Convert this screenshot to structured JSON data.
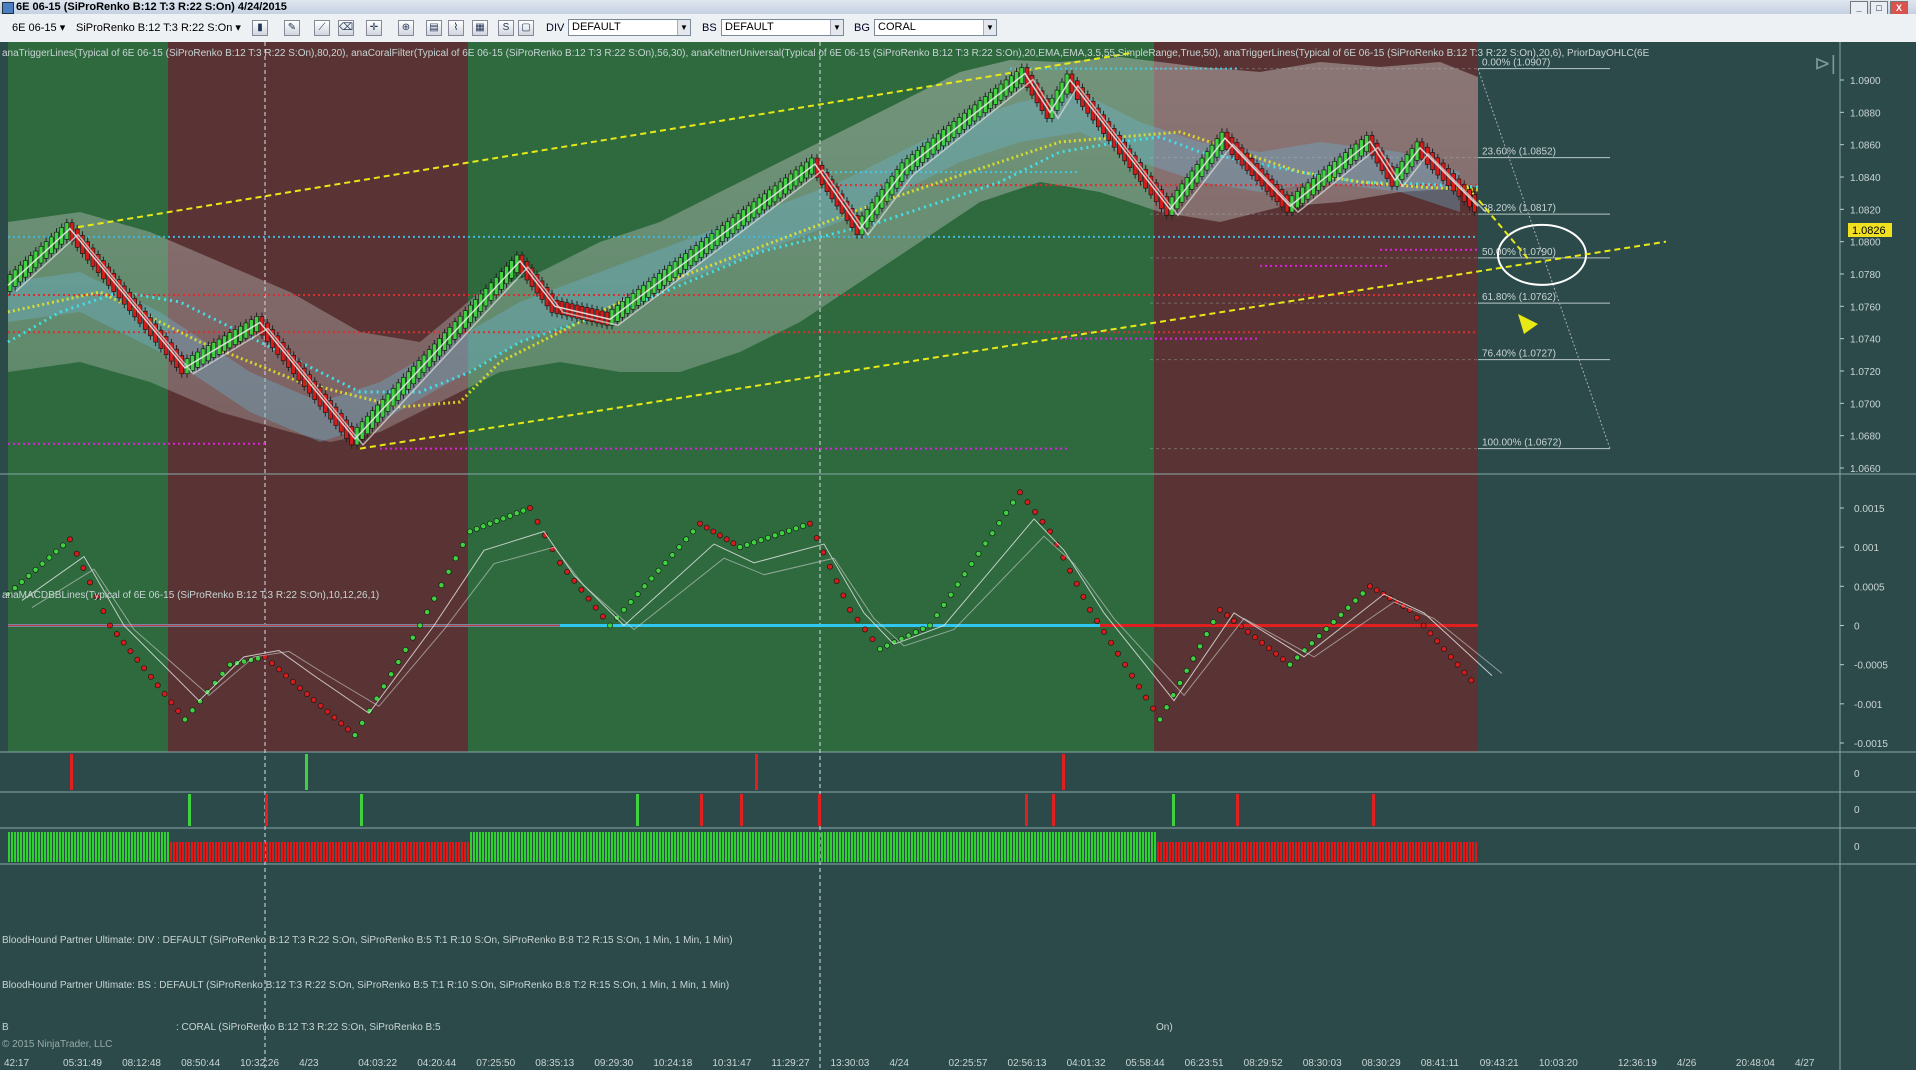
{
  "window": {
    "title": "6E 06-15 (SiProRenko B:12 T:3 R:22 S:On)  4/24/2015",
    "minimize": "_",
    "maximize": "□",
    "close": "X"
  },
  "toolbar": {
    "instrument": "6E 06-15 ▾",
    "bartype": "SiProRenko B:12 T:3 R:22 S:On ▾",
    "div_label": "DIV",
    "div_value": "DEFAULT",
    "bs_label": "BS",
    "bs_value": "DEFAULT",
    "bg_label": "BG",
    "bg_value": "CORAL"
  },
  "panels": {
    "price_header": "anaTriggerLines(Typical of 6E 06-15 (SiProRenko B:12 T:3 R:22 S:On),80,20), anaCoralFilter(Typical of 6E 06-15 (SiProRenko B:12 T:3 R:22 S:On),56,30), anaKeltnerUniversal(Typical of 6E 06-15 (SiProRenko B:12 T:3 R:22 S:On),20,EMA,EMA,3.5,55,SimpleRange,True,50), anaTriggerLines(Typical of 6E 06-15 (SiProRenko B:12 T:3 R:22 S:On),20,6), PriorDayOHLC(6E",
    "macd_header": "anaMACDBBLines(Typical of 6E 06-15 (SiProRenko B:12 T:3 R:22 S:On),10,12,26,1)",
    "div_header": "BloodHound Partner Ultimate: DIV : DEFAULT (SiProRenko B:12 T:3 R:22 S:On, SiProRenko B:5 T:1 R:10 S:On, SiProRenko B:8 T:2 R:15 S:On, 1 Min, 1 Min, 1 Min)",
    "bs_header": "BloodHound Partner Ultimate: BS : DEFAULT (SiProRenko B:12 T:3 R:22 S:On, SiProRenko B:5 T:1 R:10 S:On, SiProRenko B:8 T:2 R:15 S:On, 1 Min, 1 Min, 1 Min)",
    "bg_header_a": "B",
    "bg_header_b": ": CORAL (SiProRenko B:12 T:3 R:22 S:On, SiProRenko B:5",
    "bg_header_c": "On)",
    "copyright": "© 2015 NinjaTrader, LLC"
  },
  "price_axis": [
    "1.0900",
    "1.0880",
    "1.0860",
    "1.0840",
    "1.0820",
    "1.0800",
    "1.0780",
    "1.0760",
    "1.0740",
    "1.0720",
    "1.0700",
    "1.0680",
    "1.0660"
  ],
  "current_price": "1.0826",
  "macd_axis": [
    "0.0015",
    "0.001",
    "0.0005",
    "0",
    "-0.0005",
    "-0.001",
    "-0.0015"
  ],
  "zero_label": "0",
  "fib_levels": [
    {
      "label": "0.00% (1.0907)",
      "price": 1.0907
    },
    {
      "label": "23.60% (1.0852)",
      "price": 1.0852
    },
    {
      "label": "38.20% (1.0817)",
      "price": 1.0817
    },
    {
      "label": "50.00% (1.0790)",
      "price": 1.079
    },
    {
      "label": "61.80% (1.0762)",
      "price": 1.0762
    },
    {
      "label": "76.40% (1.0727)",
      "price": 1.0727
    },
    {
      "label": "100.00% (1.0672)",
      "price": 1.0672
    }
  ],
  "time_axis": [
    "42:17",
    "05:31:49",
    "08:12:48",
    "08:50:44",
    "10:32:26",
    "4/23",
    "04:03:22",
    "04:20:44",
    "07:25:50",
    "08:35:13",
    "09:29:30",
    "10:24:18",
    "10:31:47",
    "11:29:27",
    "13:30:03",
    "4/24",
    "02:25:57",
    "02:56:13",
    "04:01:32",
    "05:58:44",
    "06:23:51",
    "08:29:52",
    "08:30:03",
    "08:30:29",
    "08:41:11",
    "09:43:21",
    "10:03:20",
    "12:36:19",
    "4/26",
    "20:48:04",
    "4/27"
  ],
  "colors": {
    "bg_green": "#2e6a3e",
    "bg_red": "#5a3434",
    "bg_neutral": "#2d4a4a",
    "up_bar": "#3fd13f",
    "down_bar": "#d41c1c",
    "fib": "#b8c8c8",
    "trend": "#e8e817"
  }
}
